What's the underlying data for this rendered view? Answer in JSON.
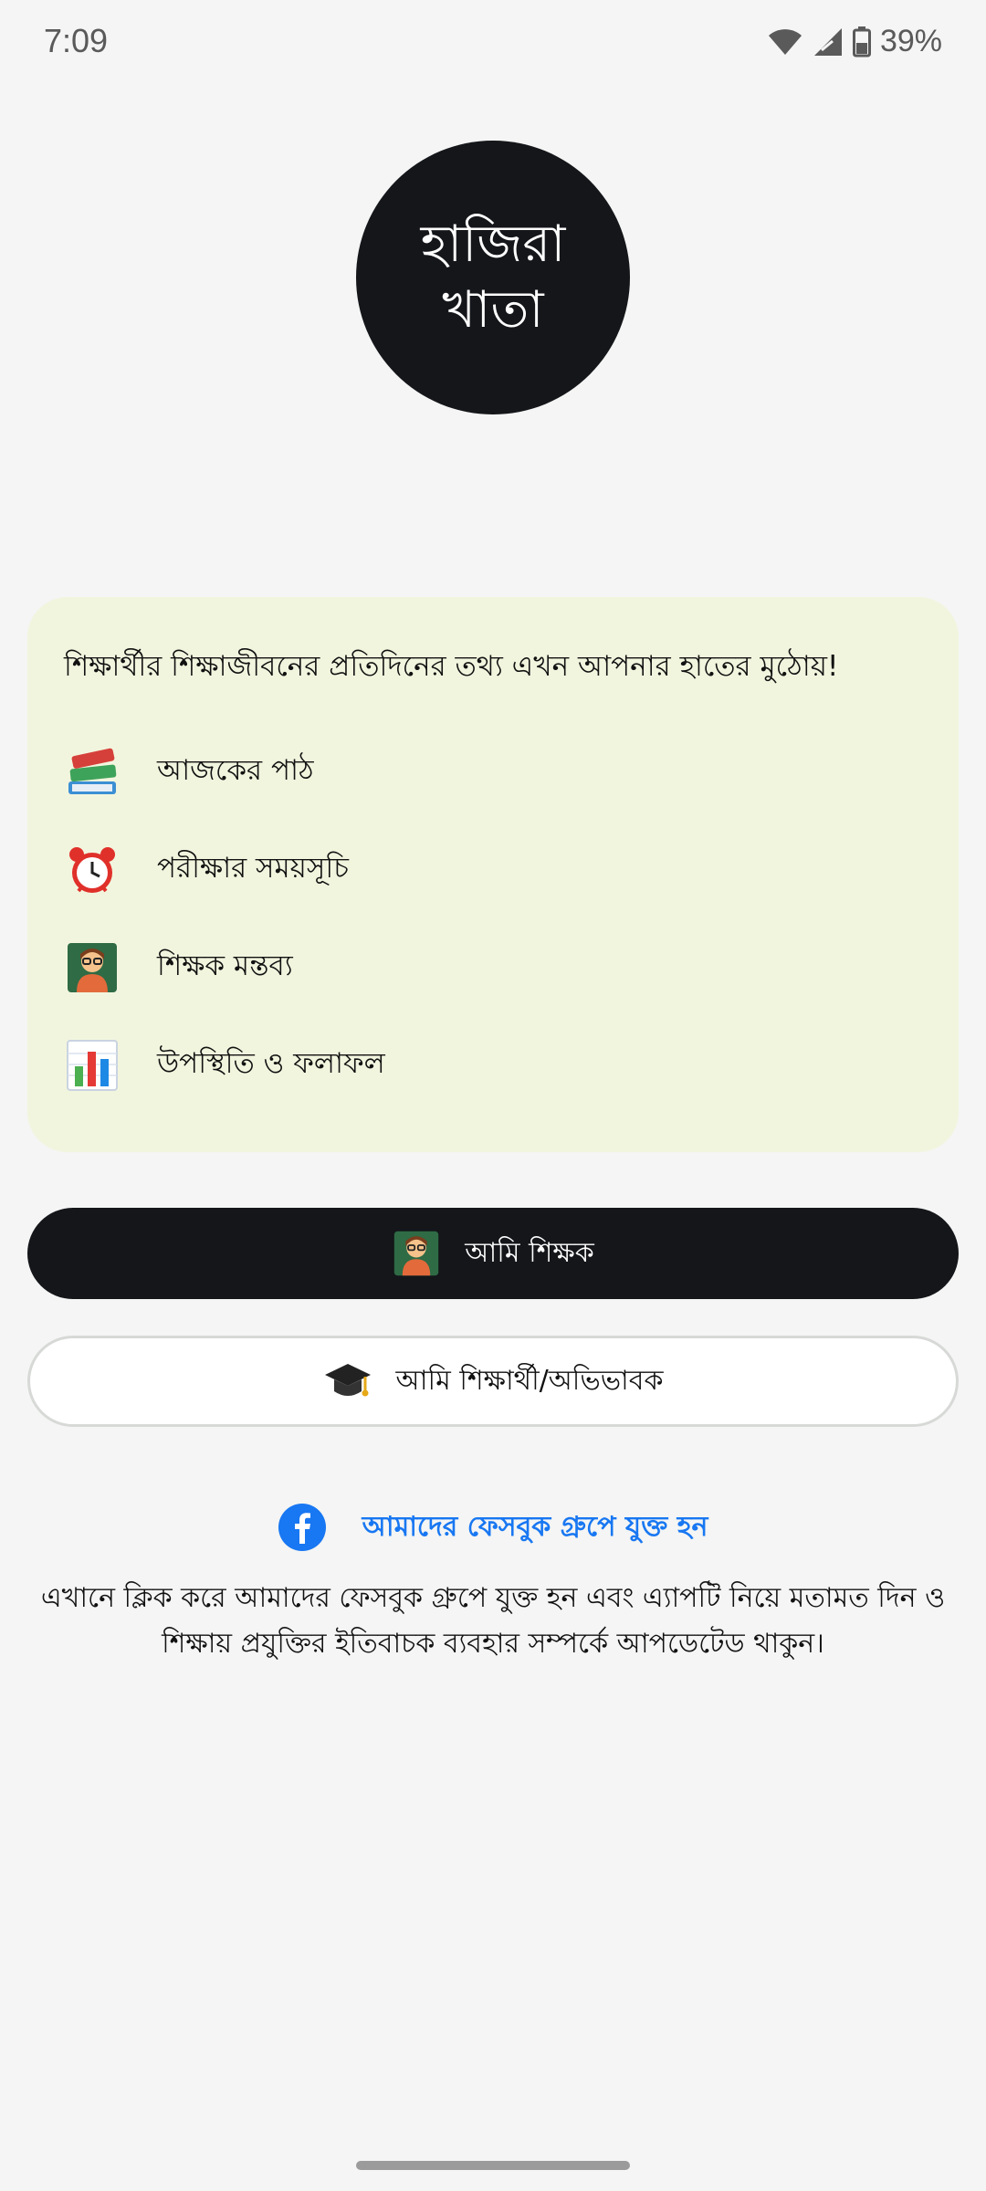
{
  "status_bar": {
    "time": "7:09",
    "battery": "39%"
  },
  "logo": {
    "line1": "হাজিরা",
    "line2": "খাতা"
  },
  "card": {
    "headline": "শিক্ষার্থীর শিক্ষাজীবনের প্রতিদিনের তথ্য এখন আপনার হাতের মুঠোয়!",
    "features": [
      {
        "icon": "books-icon",
        "label": "আজকের পাঠ"
      },
      {
        "icon": "alarm-clock-icon",
        "label": "পরীক্ষার সময়সূচি"
      },
      {
        "icon": "teacher-icon",
        "label": "শিক্ষক মন্তব্য"
      },
      {
        "icon": "bar-chart-icon",
        "label": "উপস্থিতি ও ফলাফল"
      }
    ]
  },
  "buttons": {
    "teacher": "আমি শিক্ষক",
    "student": "আমি শিক্ষার্থী/অভিভাবক"
  },
  "facebook": {
    "link_text": "আমাদের ফেসবুক গ্রুপে যুক্ত হন",
    "description": "এখানে ক্লিক করে আমাদের ফেসবুক গ্রুপে যুক্ত হন এবং এ্যাপটি নিয়ে মতামত দিন ও শিক্ষায় প্রযুক্তির ইতিবাচক ব্যবহার সম্পর্কে আপডেটেড থাকুন।"
  },
  "colors": {
    "background": "#f4f5f4",
    "dark": "#14161a",
    "card": "#f2f5de",
    "facebook_blue": "#1877f2"
  }
}
